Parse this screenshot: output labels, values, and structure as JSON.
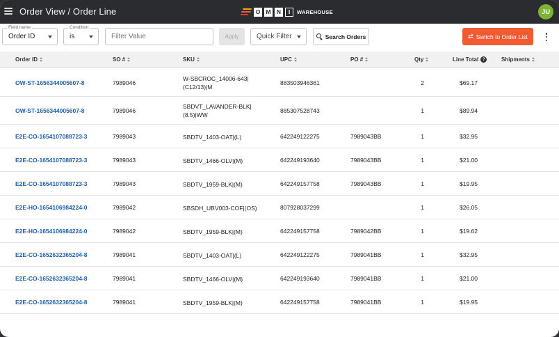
{
  "header": {
    "title": "Order View / Order Line",
    "logo_letters": [
      "O",
      "M",
      "N",
      "I"
    ],
    "logo_suffix": "WAREHOUSE",
    "user_initials": "JU",
    "avatar_color": "#7cb531"
  },
  "toolbar": {
    "field_name": {
      "label": "Field name",
      "value": "Order ID"
    },
    "condition": {
      "label": "Condition",
      "value": "is"
    },
    "filter_placeholder": "Filter Value",
    "apply_label": "Apply",
    "quick_filter": {
      "value": "Quick Filter"
    },
    "search_label": "Search Orders",
    "switch_label": "Switch to Order List",
    "switch_color": "#f25a32"
  },
  "table": {
    "columns": [
      "Order ID",
      "SO #",
      "SKU",
      "UPC",
      "PO #",
      "Qty",
      "Line Total",
      "Shipments"
    ],
    "rows": [
      {
        "order_id": "OW-ST-1656344005607-8",
        "so": "7989046",
        "sku": "W-SBCROC_14006-643|(C12/13)|M",
        "upc": "883503946361",
        "po": "",
        "qty": "2",
        "total": "$69.17",
        "shipments": ""
      },
      {
        "order_id": "OW-ST-1656344005607-8",
        "so": "7989046",
        "sku": "SBDVT_LAVANDER-BLK|(8.5)|WW",
        "upc": "885307528743",
        "po": "",
        "qty": "1",
        "total": "$89.94",
        "shipments": ""
      },
      {
        "order_id": "E2E-CO-1654107088723-3",
        "so": "7989043",
        "sku": "SBDTV_1403-OAT|(L)",
        "upc": "642249122275",
        "po": "7989043BB",
        "qty": "1",
        "total": "$32.95",
        "shipments": ""
      },
      {
        "order_id": "E2E-CO-1654107088723-3",
        "so": "7989043",
        "sku": "SBDTV_1466-OLV|(M)",
        "upc": "642249193640",
        "po": "7989043BB",
        "qty": "1",
        "total": "$21.00",
        "shipments": ""
      },
      {
        "order_id": "E2E-CO-1654107088723-3",
        "so": "7989043",
        "sku": "SBDTV_1959-BLK|(M)",
        "upc": "642249157758",
        "po": "7989043BB",
        "qty": "1",
        "total": "$19.95",
        "shipments": ""
      },
      {
        "order_id": "E2E-HO-1654106984224-0",
        "so": "7989042",
        "sku": "SBSDH_UBV003-COF|(OS)",
        "upc": "807928037299",
        "po": "",
        "qty": "1",
        "total": "$26.05",
        "shipments": ""
      },
      {
        "order_id": "E2E-HO-1654106984224-0",
        "so": "7989042",
        "sku": "SBDTV_1959-BLK|(M)",
        "upc": "642249157758",
        "po": "7989042BB",
        "qty": "1",
        "total": "$19.62",
        "shipments": ""
      },
      {
        "order_id": "E2E-CO-1652632365204-8",
        "so": "7989041",
        "sku": "SBDTV_1403-OAT|(L)",
        "upc": "642249122275",
        "po": "7989041BB",
        "qty": "1",
        "total": "$32.95",
        "shipments": ""
      },
      {
        "order_id": "E2E-CO-1652632365204-8",
        "so": "7989041",
        "sku": "SBDTV_1466-OLV|(M)",
        "upc": "642249193640",
        "po": "7989041BB",
        "qty": "1",
        "total": "$21.00",
        "shipments": ""
      },
      {
        "order_id": "E2E-CO-1652632365204-8",
        "so": "7989041",
        "sku": "SBDTV_1959-BLK|(M)",
        "upc": "642249157758",
        "po": "7989041BB",
        "qty": "1",
        "total": "$19.95",
        "shipments": ""
      }
    ]
  },
  "colors": {
    "link": "#1f5fa8",
    "topbar": "#2b2c2f"
  }
}
